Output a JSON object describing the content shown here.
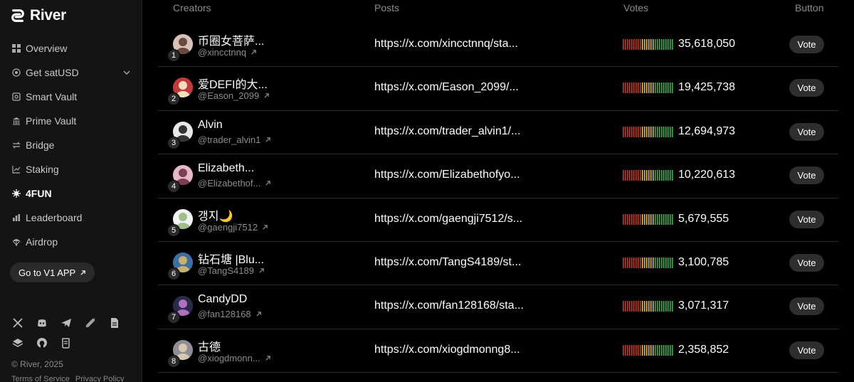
{
  "brand": {
    "name": "River"
  },
  "sidebar": {
    "items": [
      {
        "label": "Overview",
        "icon": "grid-icon"
      },
      {
        "label": "Get satUSD",
        "icon": "coin-icon",
        "has_chevron": true
      },
      {
        "label": "Smart Vault",
        "icon": "vault-icon"
      },
      {
        "label": "Prime Vault",
        "icon": "bank-icon"
      },
      {
        "label": "Bridge",
        "icon": "swap-icon"
      },
      {
        "label": "Staking",
        "icon": "chart-icon"
      },
      {
        "label": "4FUN",
        "icon": "fun-icon",
        "active": true
      },
      {
        "label": "Leaderboard",
        "icon": "bars-icon"
      },
      {
        "label": "Airdrop",
        "icon": "parachute-icon"
      }
    ],
    "v1_button": "Go to V1 APP",
    "copyright": "© River, 2025",
    "footer_links": [
      "Terms of Service",
      "Privacy Policy"
    ]
  },
  "table": {
    "headers": {
      "creators": "Creators",
      "posts": "Posts",
      "votes": "Votes",
      "button": "Button"
    },
    "rows": [
      {
        "rank": "1",
        "name": "币圈女菩萨...",
        "handle": "@xincctnnq",
        "post": "https://x.com/xincctnnq/sta...",
        "votes": "35,618,050",
        "vote_label": "Vote"
      },
      {
        "rank": "2",
        "name": "爱DEFI的大...",
        "handle": "@Eason_2099",
        "post": "https://x.com/Eason_2099/...",
        "votes": "19,425,738",
        "vote_label": "Vote"
      },
      {
        "rank": "3",
        "name": "Alvin",
        "handle": "@trader_alvin1",
        "post": "https://x.com/trader_alvin1/...",
        "votes": "12,694,973",
        "vote_label": "Vote"
      },
      {
        "rank": "4",
        "name": "Elizabeth...",
        "handle": "@Elizabethof...",
        "post": "https://x.com/Elizabethofyo...",
        "votes": "10,220,613",
        "vote_label": "Vote"
      },
      {
        "rank": "5",
        "name": "갱지🌙",
        "handle": "@gaengji7512",
        "post": "https://x.com/gaengji7512/s...",
        "votes": "5,679,555",
        "vote_label": "Vote"
      },
      {
        "rank": "6",
        "name": "钻石塘 |Blu...",
        "handle": "@TangS4189",
        "post": "https://x.com/TangS4189/st...",
        "votes": "3,100,785",
        "vote_label": "Vote"
      },
      {
        "rank": "7",
        "name": "CandyDD",
        "handle": "@fan128168",
        "post": "https://x.com/fan128168/sta...",
        "votes": "3,071,317",
        "vote_label": "Vote"
      },
      {
        "rank": "8",
        "name": "古德",
        "handle": "@xiogdmonn...",
        "post": "https://x.com/xiogdmonng8...",
        "votes": "2,358,852",
        "vote_label": "Vote"
      }
    ]
  },
  "colors": {
    "meter_low": "#c0392b",
    "meter_mid": "#e0b84a",
    "meter_high": "#3fae4b"
  }
}
